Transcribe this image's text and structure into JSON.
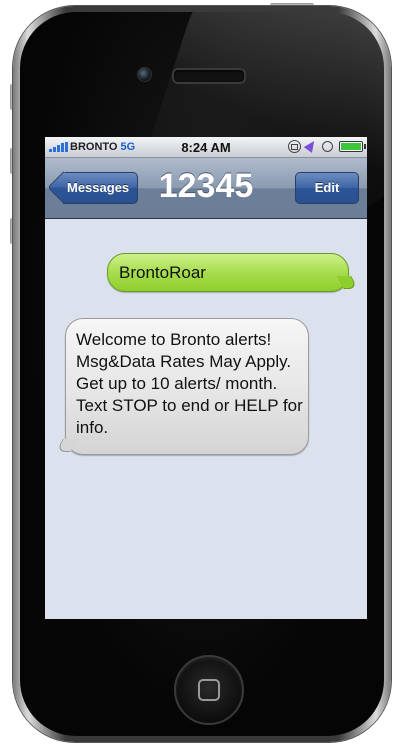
{
  "status_bar": {
    "carrier": "BRONTO",
    "network": "5G",
    "time": "8:24 AM"
  },
  "nav": {
    "back_label": "Messages",
    "title": "12345",
    "edit_label": "Edit"
  },
  "messages": [
    {
      "direction": "sent",
      "text": "BrontoRoar"
    },
    {
      "direction": "received",
      "text": "Welcome to Bronto alerts! Msg&Data Rates May Apply. Get up to 10 alerts/ month. Text STOP to end or HELP for info."
    }
  ],
  "colors": {
    "sent_bubble": "#a7dd4e",
    "received_bubble": "#e4e4e4",
    "nav_bar": "#8a9ab0",
    "screen_background": "#dbe2ed"
  }
}
